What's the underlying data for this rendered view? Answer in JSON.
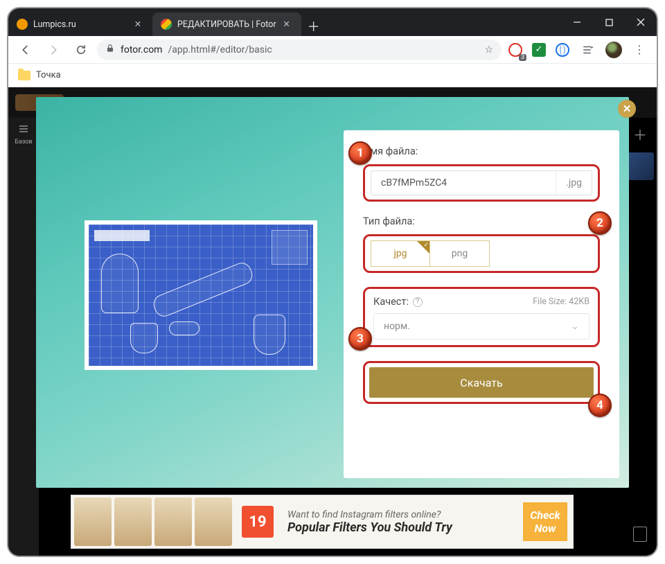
{
  "browser": {
    "tabs": [
      {
        "label": "Lumpics.ru"
      },
      {
        "label": "РЕДАКТИРОВАТЬ | Fotor"
      }
    ],
    "url_host": "fotor.com",
    "url_path": "/app.html#/editor/basic",
    "adblock_badge": "3",
    "bookmarks": [
      {
        "label": "Точка"
      }
    ]
  },
  "export": {
    "filename_label": "Имя файла:",
    "filename_value": "cB7fMPm5ZC4",
    "filename_ext": ".jpg",
    "type_label": "Тип файла:",
    "type_options": {
      "jpg": "jpg",
      "png": "png"
    },
    "quality_label": "Качест:",
    "quality_value": "норм.",
    "filesize_text": "File Size: 42KB",
    "download_label": "Скачать"
  },
  "callouts": {
    "c1": "1",
    "c2": "2",
    "c3": "3",
    "c4": "4"
  },
  "ad": {
    "number": "19",
    "line1": "Want to find Instagram filters online?",
    "line2": "Popular Filters You Should Try",
    "cta1": "Check",
    "cta2": "Now"
  },
  "sidebar_label": "Базов"
}
